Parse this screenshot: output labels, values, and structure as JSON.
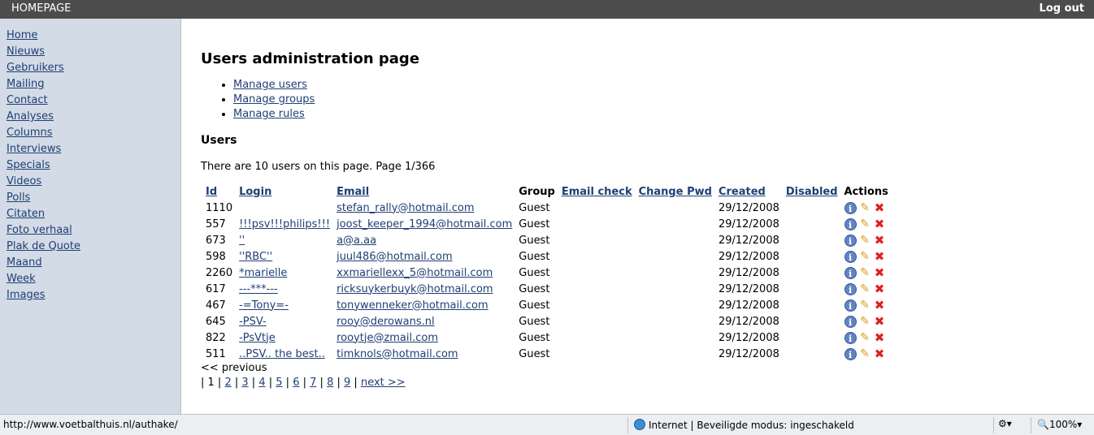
{
  "topbar": {
    "home": "HOMEPAGE",
    "logout": "Log out"
  },
  "sidebar": {
    "items": [
      {
        "label": "Home"
      },
      {
        "label": "Nieuws"
      },
      {
        "label": "Gebruikers"
      },
      {
        "label": "Mailing"
      },
      {
        "label": "Contact"
      },
      {
        "label": "Analyses"
      },
      {
        "label": "Columns"
      },
      {
        "label": "Interviews"
      },
      {
        "label": "Specials"
      },
      {
        "label": "Videos"
      },
      {
        "label": "Polls"
      },
      {
        "label": "Citaten"
      },
      {
        "label": "Foto verhaal"
      },
      {
        "label": "Plak de Quote"
      },
      {
        "label": "Maand"
      },
      {
        "label": "Week"
      },
      {
        "label": "Images"
      }
    ]
  },
  "main": {
    "title": "Users administration page",
    "links": [
      {
        "label": "Manage users"
      },
      {
        "label": "Manage groups"
      },
      {
        "label": "Manage rules"
      }
    ],
    "section_title": "Users",
    "count_text": "There are 10 users on this page. Page 1/366",
    "columns": {
      "id": "Id",
      "login": "Login",
      "email": "Email",
      "group": "Group",
      "email_check": "Email check",
      "change_pwd": "Change Pwd",
      "created": "Created",
      "disabled": "Disabled",
      "actions": "Actions"
    },
    "rows": [
      {
        "id": "1110",
        "login": "",
        "email": "stefan_rally@hotmail.com",
        "group": "Guest",
        "created": "29/12/2008"
      },
      {
        "id": "557",
        "login": "!!!psv!!!philips!!!",
        "email": "joost_keeper_1994@hotmail.com",
        "group": "Guest",
        "created": "29/12/2008"
      },
      {
        "id": "673",
        "login": "''",
        "email": "a@a.aa",
        "group": "Guest",
        "created": "29/12/2008"
      },
      {
        "id": "598",
        "login": "''RBC''",
        "email": "juul486@hotmail.com",
        "group": "Guest",
        "created": "29/12/2008"
      },
      {
        "id": "2260",
        "login": "*marielle",
        "email": "xxmariellexx_5@hotmail.com",
        "group": "Guest",
        "created": "29/12/2008"
      },
      {
        "id": "617",
        "login": "---***---",
        "email": "ricksuykerbuyk@hotmail.com",
        "group": "Guest",
        "created": "29/12/2008"
      },
      {
        "id": "467",
        "login": "-=Tony=-",
        "email": "tonywenneker@hotmail.com",
        "group": "Guest",
        "created": "29/12/2008"
      },
      {
        "id": "645",
        "login": "-PSV-",
        "email": "rooy@derowans.nl",
        "group": "Guest",
        "created": "29/12/2008"
      },
      {
        "id": "822",
        "login": "-PsVtje",
        "email": "rooytje@zmail.com",
        "group": "Guest",
        "created": "29/12/2008"
      },
      {
        "id": "511",
        "login": "..PSV.. the best..",
        "email": "timknols@hotmail.com",
        "group": "Guest",
        "created": "29/12/2008"
      }
    ],
    "previous": "<< previous",
    "pager": {
      "pages": [
        "1",
        "2",
        "3",
        "4",
        "5",
        "6",
        "7",
        "8",
        "9"
      ],
      "current": "1",
      "next": "next >>"
    }
  },
  "statusbar": {
    "url": "http://www.voetbalthuis.nl/authake/",
    "zone": "Internet | Beveiligde modus: ingeschakeld",
    "zoom": "100%"
  },
  "colors": {
    "topbar": "#4c4c4c",
    "sidebar": "#d3dbe6",
    "link": "#1f3f74"
  },
  "icons": {
    "info": "info-icon",
    "edit": "pencil-icon",
    "delete": "delete-icon"
  }
}
